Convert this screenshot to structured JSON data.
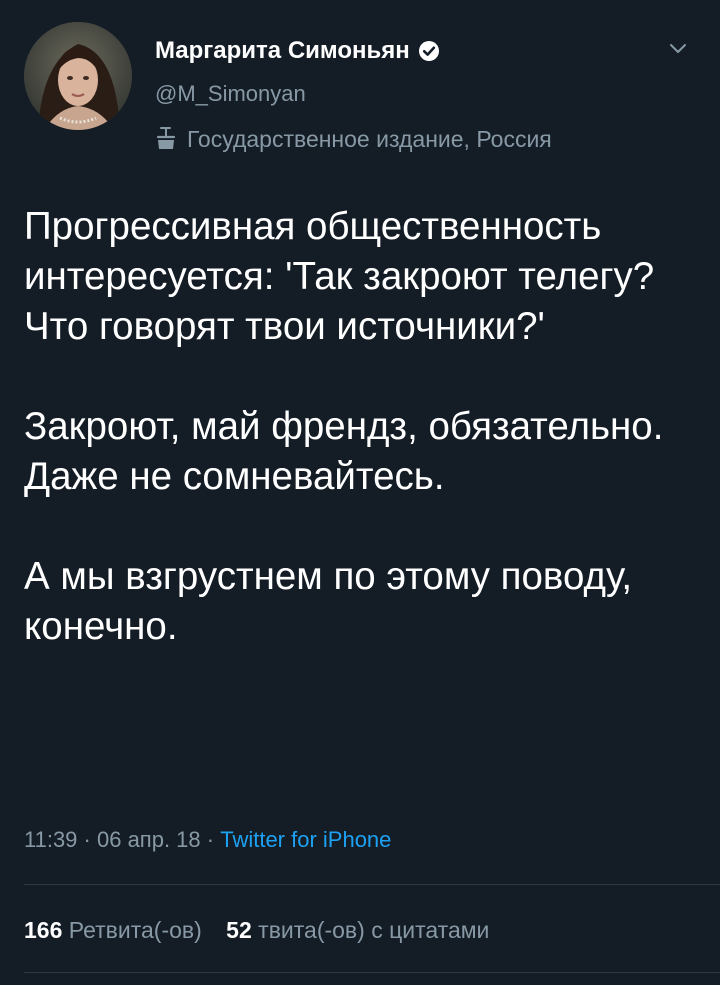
{
  "tweet": {
    "author": {
      "name": "Маргарита Симоньян",
      "handle": "@M_Simonyan",
      "label": "Государственное издание, Россия",
      "verified": true
    },
    "paragraphs": [
      "Прогрессивная общественность интересуется: 'Так закроют телегу? Что говорят твои источники?'",
      "Закроют, май френдз, обязательно. Даже не сомневайтесь.",
      "А мы взгрустнем по этому поводу, конечно."
    ],
    "meta": {
      "time": "11:39",
      "sep1": " · ",
      "date": "06 апр. 18",
      "sep2": " · ",
      "source": "Twitter for iPhone"
    },
    "stats": {
      "retweets_count": "166",
      "retweets_label": "Ретвита(-ов)",
      "quotes_count": "52",
      "quotes_label": "твита(-ов) с цитатами"
    }
  },
  "colors": {
    "background": "#141d26",
    "text_primary": "#ffffff",
    "text_secondary": "#8899a6",
    "link": "#1da1f2",
    "divider": "#2b3945"
  },
  "icons": {
    "verified": "verified-badge-icon",
    "caret": "chevron-down-icon",
    "label": "state-media-icon"
  }
}
